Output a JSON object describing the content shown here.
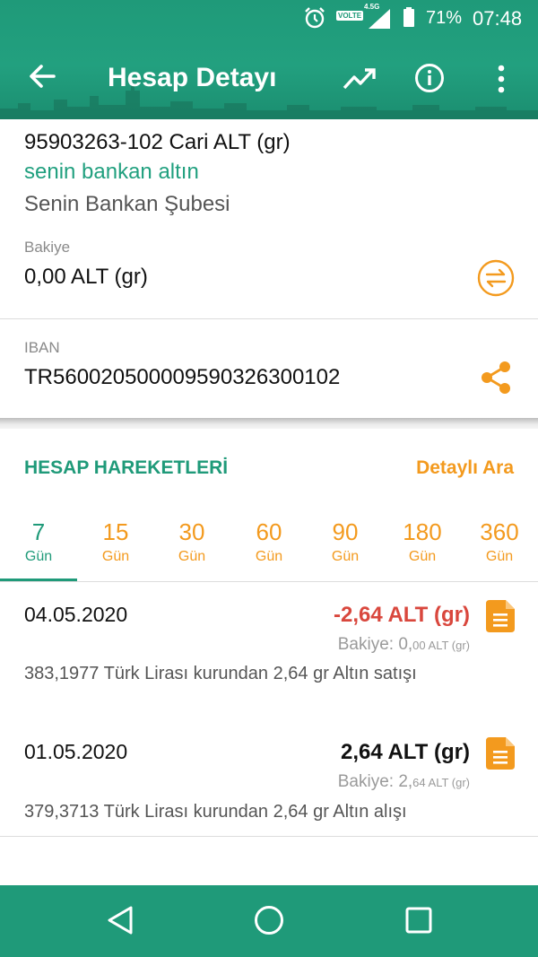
{
  "status_bar": {
    "network_label": "VOLTE",
    "network_type": "4.5G",
    "battery": "71%",
    "time": "07:48"
  },
  "toolbar": {
    "title": "Hesap Detayı",
    "icons": [
      "back-arrow-icon",
      "trending-icon",
      "info-icon",
      "more-vert-icon"
    ]
  },
  "account": {
    "name": "95903263-102 Cari ALT (gr)",
    "type": "senin bankan altın",
    "branch": "Senin Bankan Şubesi",
    "balance_label": "Bakiye",
    "balance": "0,00 ALT (gr)",
    "iban_label": "IBAN",
    "iban": "TR560020500009590326300102"
  },
  "transactions_section": {
    "title": "HESAP HAREKETLERİ",
    "detail_search": "Detaylı Ara"
  },
  "day_tabs": [
    {
      "value": "7",
      "unit": "Gün",
      "active": true
    },
    {
      "value": "15",
      "unit": "Gün"
    },
    {
      "value": "30",
      "unit": "Gün"
    },
    {
      "value": "60",
      "unit": "Gün"
    },
    {
      "value": "90",
      "unit": "Gün"
    },
    {
      "value": "180",
      "unit": "Gün"
    },
    {
      "value": "360",
      "unit": "Gün"
    }
  ],
  "transactions": [
    {
      "date": "04.05.2020",
      "amount": "-2,64 ALT (gr)",
      "balance_prefix": "Bakiye: 0,",
      "balance_rest": "00 ALT (gr)",
      "description": "383,1977 Türk Lirası kurundan 2,64 gr Altın satışı"
    },
    {
      "date": "01.05.2020",
      "amount": "2,64 ALT (gr)",
      "balance_prefix": "Bakiye: 2,",
      "balance_rest": "64 ALT (gr)",
      "description": "379,3713 Türk Lirası kurundan 2,64 gr Altın alışı"
    }
  ],
  "colors": {
    "primary": "#1f9a79",
    "accent": "#f39a1e",
    "negative": "#d9473d"
  }
}
